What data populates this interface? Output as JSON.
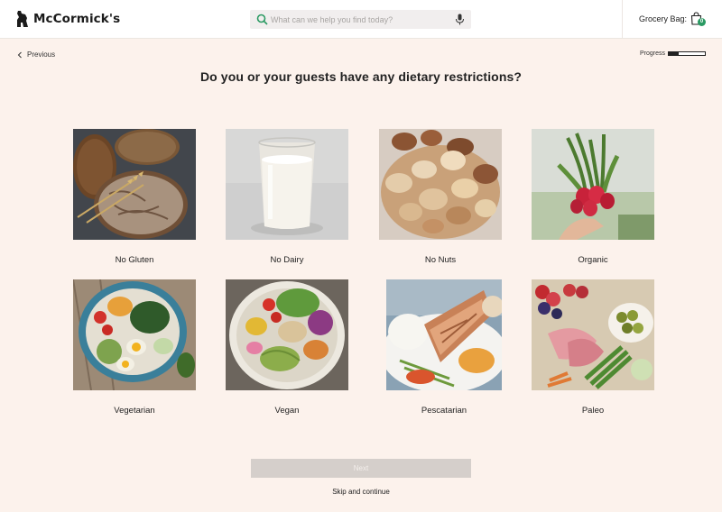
{
  "header": {
    "brand": "McCormick's",
    "search": {
      "placeholder": "What can we help you find today?",
      "value": ""
    },
    "grocery_bag_label": "Grocery Bag:",
    "bag_count": "0"
  },
  "nav": {
    "previous_label": "Previous",
    "progress_label": "Progress",
    "progress_fraction": 0.28
  },
  "question": "Do you or your guests have any dietary restrictions?",
  "options": [
    {
      "label": "No Gluten",
      "image": "bread-loaves-photo"
    },
    {
      "label": "No Dairy",
      "image": "glass-of-milk-photo"
    },
    {
      "label": "No Nuts",
      "image": "mixed-nuts-photo"
    },
    {
      "label": "Organic",
      "image": "radishes-bunch-photo"
    },
    {
      "label": "Vegetarian",
      "image": "salad-bowl-with-egg-photo"
    },
    {
      "label": "Vegan",
      "image": "vegan-bowl-photo"
    },
    {
      "label": "Pescatarian",
      "image": "salmon-plate-photo"
    },
    {
      "label": "Paleo",
      "image": "meat-and-fruit-platter-photo"
    }
  ],
  "footer": {
    "next_label": "Next",
    "skip_label": "Skip and continue"
  },
  "colors": {
    "page_background": "#fcf2ec",
    "accent_green": "#2b9a63",
    "next_button_disabled": "#d5cfcb"
  }
}
